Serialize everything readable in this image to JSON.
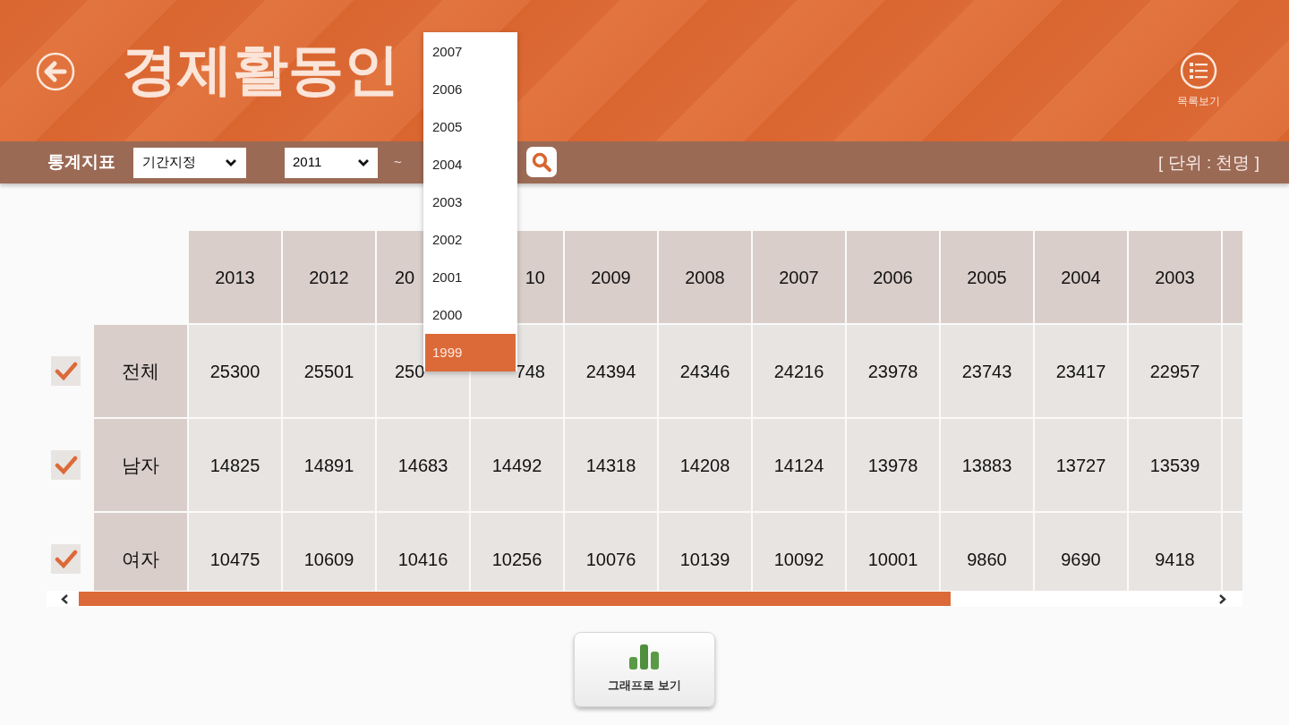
{
  "header": {
    "title": "경제활동인",
    "list_label": "목록보기"
  },
  "toolbar": {
    "label": "통계지표",
    "period_select": "기간지정",
    "start_year": "2011",
    "range_separator": "~",
    "unit": "[ 단위 : 천명 ]"
  },
  "year_dropdown": [
    {
      "label": "2007",
      "selected": false
    },
    {
      "label": "2006",
      "selected": false
    },
    {
      "label": "2005",
      "selected": false
    },
    {
      "label": "2004",
      "selected": false
    },
    {
      "label": "2003",
      "selected": false
    },
    {
      "label": "2002",
      "selected": false
    },
    {
      "label": "2001",
      "selected": false
    },
    {
      "label": "2000",
      "selected": false
    },
    {
      "label": "1999",
      "selected": true
    }
  ],
  "table": {
    "columns": [
      {
        "label": "2013"
      },
      {
        "label": "2012"
      },
      {
        "label": "20"
      },
      {
        "label": "10"
      },
      {
        "label": "2009"
      },
      {
        "label": "2008"
      },
      {
        "label": "2007"
      },
      {
        "label": "2006"
      },
      {
        "label": "2005"
      },
      {
        "label": "2004"
      },
      {
        "label": "2003"
      }
    ],
    "rows": [
      {
        "label": "전체",
        "checked": true,
        "cells": [
          "25300",
          "25501",
          "250",
          "748",
          "24394",
          "24346",
          "24216",
          "23978",
          "23743",
          "23417",
          "22957"
        ]
      },
      {
        "label": "남자",
        "checked": true,
        "cells": [
          "14825",
          "14891",
          "14683",
          "14492",
          "14318",
          "14208",
          "14124",
          "13978",
          "13883",
          "13727",
          "13539"
        ]
      },
      {
        "label": "여자",
        "checked": true,
        "cells": [
          "10475",
          "10609",
          "10416",
          "10256",
          "10076",
          "10139",
          "10092",
          "10001",
          "9860",
          "9690",
          "9418"
        ]
      }
    ]
  },
  "graph_button": "그래프로 보기"
}
